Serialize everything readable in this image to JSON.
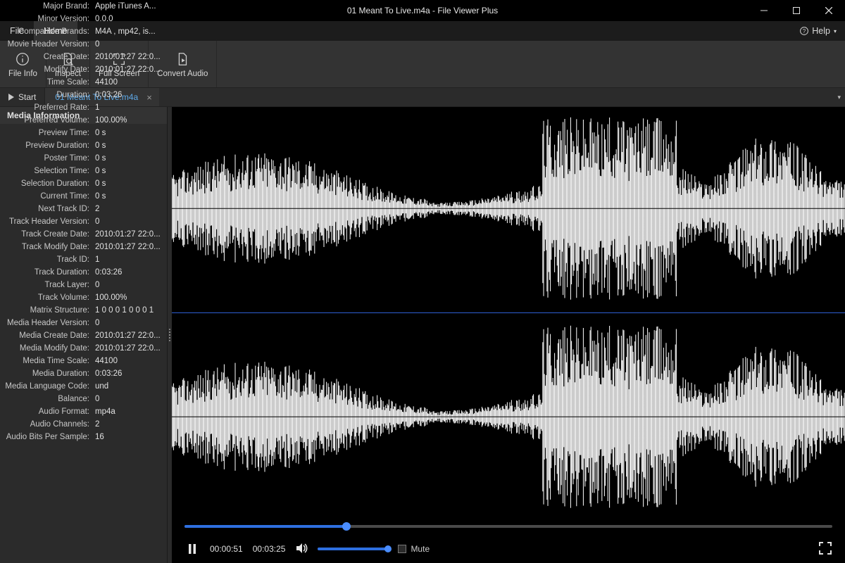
{
  "window": {
    "title": "01 Meant To Live.m4a - File Viewer Plus"
  },
  "menu": {
    "file": "File",
    "home": "Home",
    "help": "Help"
  },
  "ribbon": {
    "file_info": "File Info",
    "inspect": "Inspect",
    "full_screen": "Full Screen",
    "convert_audio": "Convert Audio"
  },
  "tabs": {
    "start": "Start",
    "doc": "01 Meant To Live.m4a"
  },
  "sidebar_header": "Media Information",
  "props": [
    {
      "k": "Major Brand:",
      "v": "Apple iTunes A..."
    },
    {
      "k": "Minor Version:",
      "v": "0.0.0"
    },
    {
      "k": "Compatible Brands:",
      "v": "M4A , mp42, is..."
    },
    {
      "k": "Movie Header Version:",
      "v": "0"
    },
    {
      "k": "Create Date:",
      "v": "2010:01:27 22:0..."
    },
    {
      "k": "Modify Date:",
      "v": "2010:01:27 22:0..."
    },
    {
      "k": "Time Scale:",
      "v": "44100"
    },
    {
      "k": "Duration:",
      "v": "0:03:26"
    },
    {
      "k": "Preferred Rate:",
      "v": "1"
    },
    {
      "k": "Preferred Volume:",
      "v": "100.00%"
    },
    {
      "k": "Preview Time:",
      "v": "0 s"
    },
    {
      "k": "Preview Duration:",
      "v": "0 s"
    },
    {
      "k": "Poster Time:",
      "v": "0 s"
    },
    {
      "k": "Selection Time:",
      "v": "0 s"
    },
    {
      "k": "Selection Duration:",
      "v": "0 s"
    },
    {
      "k": "Current Time:",
      "v": "0 s"
    },
    {
      "k": "Next Track ID:",
      "v": "2"
    },
    {
      "k": "Track Header Version:",
      "v": "0"
    },
    {
      "k": "Track Create Date:",
      "v": "2010:01:27 22:0..."
    },
    {
      "k": "Track Modify Date:",
      "v": "2010:01:27 22:0..."
    },
    {
      "k": "Track ID:",
      "v": "1"
    },
    {
      "k": "Track Duration:",
      "v": "0:03:26"
    },
    {
      "k": "Track Layer:",
      "v": "0"
    },
    {
      "k": "Track Volume:",
      "v": "100.00%"
    },
    {
      "k": "Matrix Structure:",
      "v": "1 0 0 0 1 0 0 0 1"
    },
    {
      "k": "Media Header Version:",
      "v": "0"
    },
    {
      "k": "Media Create Date:",
      "v": "2010:01:27 22:0..."
    },
    {
      "k": "Media Modify Date:",
      "v": "2010:01:27 22:0..."
    },
    {
      "k": "Media Time Scale:",
      "v": "44100"
    },
    {
      "k": "Media Duration:",
      "v": "0:03:26"
    },
    {
      "k": "Media Language Code:",
      "v": "und"
    },
    {
      "k": "Balance:",
      "v": "0"
    },
    {
      "k": "Audio Format:",
      "v": "mp4a"
    },
    {
      "k": "Audio Channels:",
      "v": "2"
    },
    {
      "k": "Audio Bits Per Sample:",
      "v": "16"
    }
  ],
  "player": {
    "elapsed": "00:00:51",
    "total": "00:03:25",
    "mute": "Mute",
    "progress_pct": 25,
    "volume_pct": 100
  }
}
